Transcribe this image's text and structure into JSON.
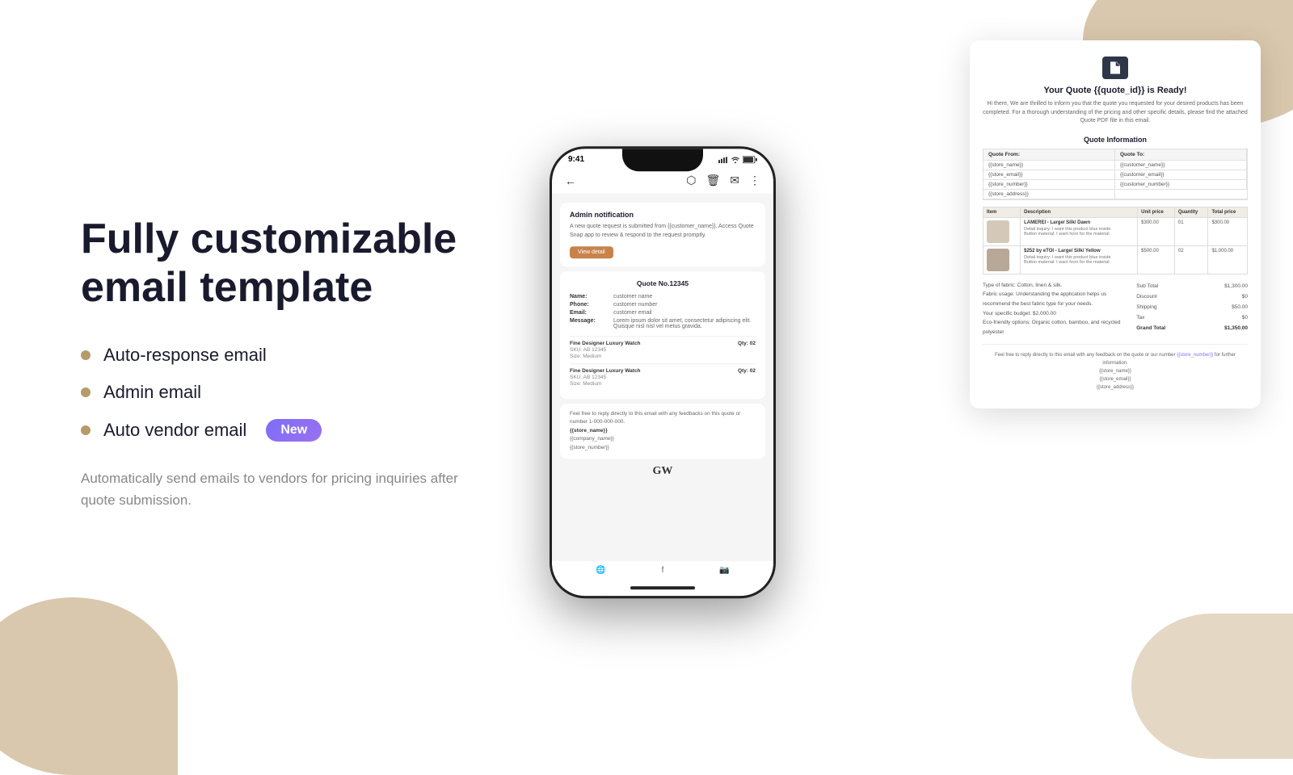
{
  "background": {
    "shape_color": "#c9b08a"
  },
  "left": {
    "headline": "Fully customizable email template",
    "features": [
      {
        "id": "auto-response",
        "label": "Auto-response email",
        "badge": null
      },
      {
        "id": "admin-email",
        "label": "Admin email",
        "badge": null
      },
      {
        "id": "vendor-email",
        "label": "Auto vendor email",
        "badge": "New"
      }
    ],
    "description": "Automatically send emails to vendors for pricing inquiries after quote submission."
  },
  "email_template": {
    "logo_alt": "document-icon",
    "title": "Your Quote {{quote_id}} is Ready!",
    "intro": "Hi there, We are thrilled to inform you that the quote you requested for your desired products has been completed. For a thorough understanding of the pricing and other specific details, please find the attached Quote PDF file in this email.",
    "quote_info_title": "Quote Information",
    "quote_from_label": "Quote From:",
    "quote_to_label": "Quote To:",
    "quote_from_fields": [
      "{{store_name}}",
      "{{store_email}}",
      "{{store_number}}",
      "{{store_address}}"
    ],
    "quote_to_fields": [
      "{{customer_name}}",
      "{{customer_email}}",
      "{{customer_number}}",
      ""
    ],
    "table_headers": [
      "Item",
      "Description",
      "Unit price",
      "Quantity",
      "Total price"
    ],
    "items": [
      {
        "img_alt": "product-1",
        "name": "LAMEREI - Large/ Silk/ Dawn",
        "unit_price": "$300.00",
        "qty": "01",
        "total": "$300.00",
        "details": [
          "Detail inquiry: I want this product blue inside",
          "Button material: I want horn for the material"
        ]
      },
      {
        "img_alt": "product-2",
        "name": "$252 by eTOI - Large/ Silk/ Yellow",
        "unit_price": "$500.00",
        "qty": "02",
        "total": "$1,000.00",
        "details": [
          "Detail inquiry: I want this product blue inside",
          "Button material: I want horn for the material"
        ]
      }
    ],
    "fabric_notes": [
      "Type of fabric: Cotton, linen & silk.",
      "Fabric usage: Understanding the application helps us recommend the best fabric type for your needs.",
      "Your specific budget: $2,000.00",
      "Eco-friendly options: Organic cotton, bamboo, and recycled polyester"
    ],
    "totals": {
      "sub_total_label": "Sub Total",
      "sub_total_value": "$1,300.00",
      "discount_label": "Discount",
      "discount_value": "$0",
      "shipping_label": "Shipping",
      "shipping_value": "$50.00",
      "tax_label": "Tax",
      "tax_value": "$0",
      "grand_total_label": "Grand Total",
      "grand_total_value": "$1,350.00"
    },
    "footer_text": "Feel free to reply directly to this email with any feedback on the quote or our number",
    "footer_link": "{{store_number}}",
    "footer_link_suffix": "for further information.",
    "footer_store_name": "{{store_name}}",
    "footer_store_email": "{{store_email}}",
    "footer_store_address": "{{store_address}}"
  },
  "phone": {
    "time": "9:41",
    "admin_notification": {
      "title": "Admin notification",
      "text": "A new quote request is submitted from {{customer_name}}. Access Quote Snap app to review & respond to the request promptly.",
      "btn_label": "View detail"
    },
    "quote_no": "Quote No.12345",
    "fields": [
      {
        "label": "Name:",
        "value": "customer name"
      },
      {
        "label": "Phone:",
        "value": "customer number"
      },
      {
        "label": "Email:",
        "value": "customer email"
      },
      {
        "label": "Message:",
        "value": "Lorem ipsum dolor sit amet, consectetur adipiscing elit. Quisque nisl nisl vel metus gravida."
      }
    ],
    "items": [
      {
        "name": "Fine Designer Luxury Watch",
        "sku": "SKU: AB 12345",
        "size": "Size: Medium",
        "qty": "Qty: 02"
      },
      {
        "name": "Fine Designer Luxury Watch",
        "sku": "SKU: AB 12345",
        "size": "Size: Medium",
        "qty": "Qty: 02"
      }
    ],
    "footer_text": "Feel free to reply directly to this email with any feedbacks on this quote or number 1-000-000-000.",
    "store_name": "{{store_name}}",
    "company_name": "{{company_name}}",
    "store_number": "{{store_number}}",
    "brand": "GW"
  },
  "badge": {
    "new_label": "New",
    "bg_color": "#7c6ff7"
  }
}
